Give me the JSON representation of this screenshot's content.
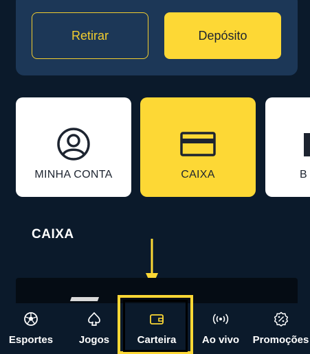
{
  "wallet": {
    "withdraw_label": "Retirar",
    "deposit_label": "Depósito"
  },
  "tiles": [
    {
      "label": "MINHA CONTA",
      "icon": "user-circle-icon"
    },
    {
      "label": "CAIXA",
      "icon": "credit-card-icon",
      "active": true
    },
    {
      "label": "B",
      "icon": "partial-icon"
    }
  ],
  "section": {
    "title": "CAIXA"
  },
  "bottom_nav": {
    "items": [
      {
        "label": "Esportes",
        "icon": "soccer-ball-icon"
      },
      {
        "label": "Jogos",
        "icon": "spade-icon"
      },
      {
        "label": "Carteira",
        "icon": "wallet-icon",
        "active": true
      },
      {
        "label": "Ao vivo",
        "icon": "live-broadcast-icon"
      },
      {
        "label": "Promoções",
        "icon": "percent-badge-icon"
      }
    ]
  },
  "colors": {
    "background": "#0b1a2b",
    "panel": "#1c3757",
    "accent": "#fdd835",
    "tile": "#ffffff"
  }
}
